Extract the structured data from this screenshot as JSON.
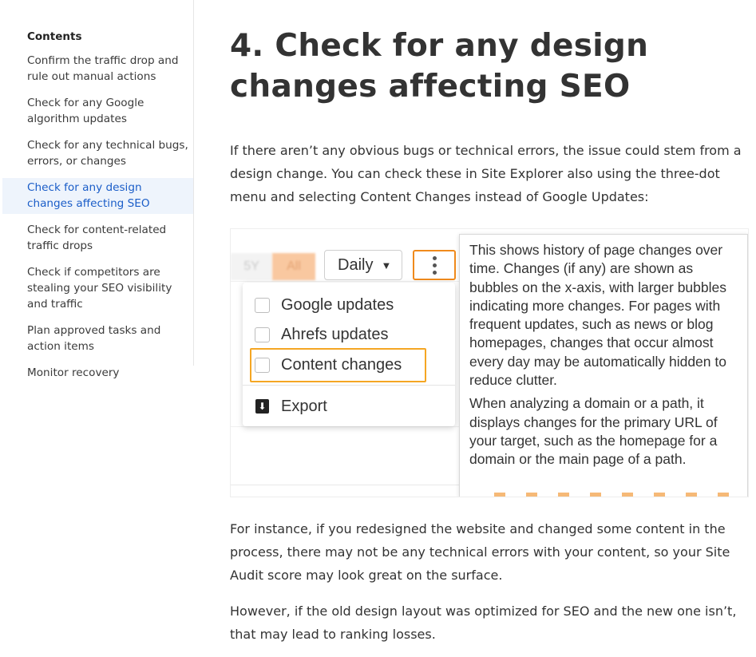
{
  "toc": {
    "heading": "Contents",
    "items": [
      {
        "label": "Confirm the traffic drop and rule out manual actions"
      },
      {
        "label": "Check for any Google algorithm updates"
      },
      {
        "label": "Check for any technical bugs, errors, or changes"
      },
      {
        "label": "Check for any design changes affecting SEO",
        "active": true
      },
      {
        "label": "Check for content-related traffic drops"
      },
      {
        "label": "Check if competitors are stealing your SEO visibility and traffic"
      },
      {
        "label": "Plan approved tasks and action items"
      },
      {
        "label": "Monitor recovery"
      }
    ]
  },
  "article": {
    "heading": "4. Check for any design changes affecting SEO",
    "paragraphs": [
      "If there aren’t any obvious bugs or technical errors, the issue could stem from a design change. You can check these in Site Explorer also using the three-dot menu and selecting Content Changes instead of Google Updates:",
      "For instance, if you redesigned the website and changed some content in the process, there may not be any technical errors with your content, so your Site Audit score may look great on the surface.",
      "However, if the old design layout was optimized for SEO and the new one isn’t, that may lead to ranking losses."
    ]
  },
  "screenshot": {
    "range_buttons": [
      "5Y",
      "All"
    ],
    "granularity": "Daily",
    "more_icon": "three-dot-vertical-icon",
    "menu_items": [
      "Google updates",
      "Ahrefs updates",
      "Content changes"
    ],
    "export_label": "Export",
    "tooltip": [
      "This shows history of page changes over time. Changes (if any) are shown as bubbles on the x-axis, with larger bubbles indicating more changes. For pages with frequent updates, such as news or blog homepages, changes that occur almost every day may be automatically hidden to reduce clutter.",
      "When analyzing a domain or a path, it displays changes for the primary URL of your target, such as the homepage for a domain or the main page of a path."
    ],
    "colors": {
      "highlight": "#f5a623",
      "more_border": "#f08a1c",
      "active_range": "#f9c8a0"
    }
  }
}
